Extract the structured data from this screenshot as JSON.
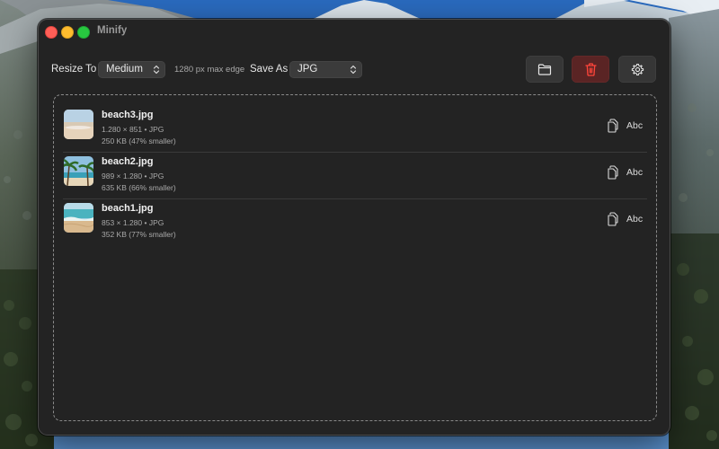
{
  "window": {
    "title": "Minify"
  },
  "toolbar": {
    "resize_label": "Resize To",
    "resize_value": "Medium",
    "resize_hint": "1280 px max edge",
    "save_label": "Save As",
    "save_value": "JPG",
    "icons": {
      "open": "folder-icon",
      "clear": "trash-icon",
      "settings": "gear-icon"
    }
  },
  "files": [
    {
      "name": "beach3.jpg",
      "meta": "1.280 × 851 • JPG",
      "size": "250 KB (47% smaller)",
      "action_label": "Abc"
    },
    {
      "name": "beach2.jpg",
      "meta": "989 × 1.280 • JPG",
      "size": "635 KB (66% smaller)",
      "action_label": "Abc"
    },
    {
      "name": "beach1.jpg",
      "meta": "853 × 1.280 • JPG",
      "size": "352 KB (77% smaller)",
      "action_label": "Abc"
    }
  ],
  "colors": {
    "window_bg": "#232323",
    "danger": "#e0443e",
    "traffic_close": "#ff5f57",
    "traffic_min": "#febc2e",
    "traffic_max": "#28c840"
  }
}
